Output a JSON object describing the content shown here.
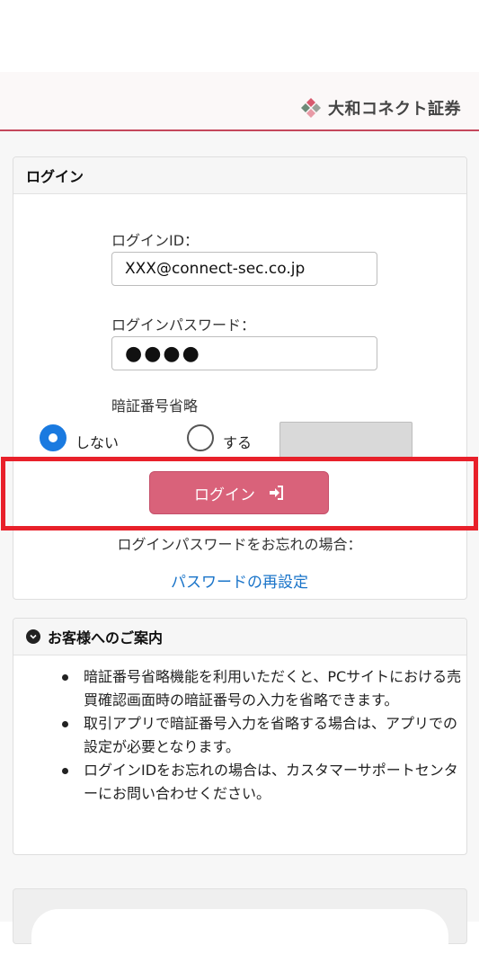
{
  "brand": {
    "name": "大和コネクト証券"
  },
  "login": {
    "header": "ログイン",
    "id_label": "ログインID：",
    "id_value": "XXX@connect-sec.co.jp",
    "pw_label": "ログインパスワード：",
    "pw_value": "●●●●",
    "pin_label": "暗証番号省略",
    "option_no": "しない",
    "option_yes": "する",
    "button_label": "ログイン",
    "forgot_text": "ログインパスワードをお忘れの場合：",
    "reset_link": "パスワードの再設定"
  },
  "guide": {
    "header": "お客様へのご案内",
    "items": [
      "暗証番号省略機能を利用いただくと、PCサイトにおける売買確認画面時の暗証番号の入力を省略できます。",
      "取引アプリで暗証番号入力を省略する場合は、アプリでの設定が必要となります。",
      "ログインIDをお忘れの場合は、カスタマーサポートセンターにお問い合わせください。"
    ]
  },
  "colors": {
    "accent": "#d9627a",
    "header_border": "#c4475c",
    "link": "#1a74c9",
    "radio": "#1a7ae0",
    "highlight": "#e8202a"
  }
}
